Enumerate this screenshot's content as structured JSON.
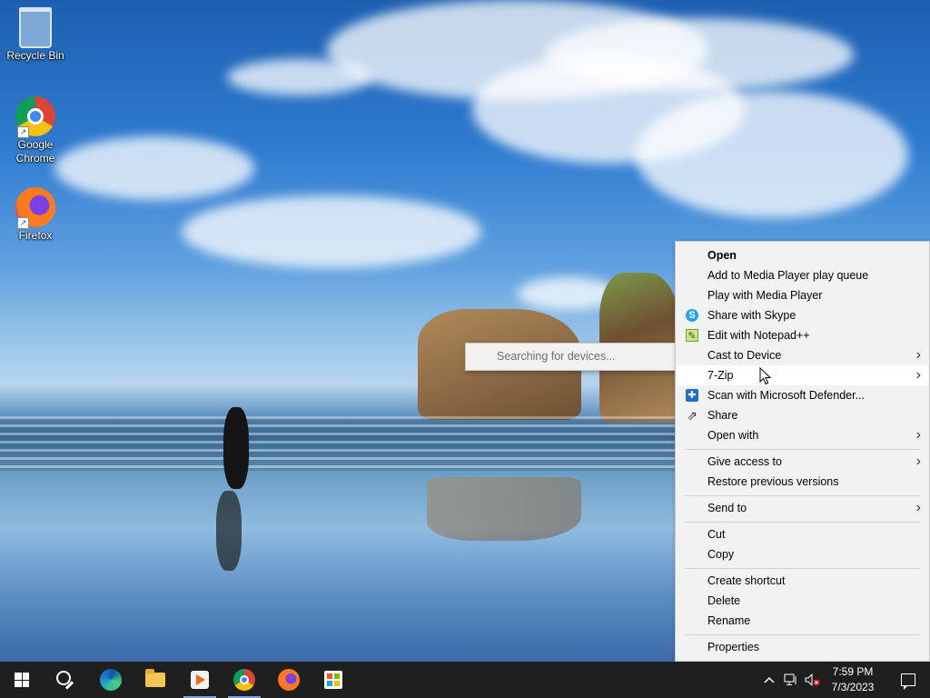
{
  "desktop": {
    "icons": [
      {
        "label": "Recycle Bin",
        "icon": "recycle-bin-icon"
      },
      {
        "label": "Google Chrome",
        "icon": "chrome-icon"
      },
      {
        "label": "Firefox",
        "icon": "firefox-icon"
      }
    ]
  },
  "context_menu": {
    "items": [
      {
        "label": "Open",
        "bold": true
      },
      {
        "label": "Add to Media Player play queue"
      },
      {
        "label": "Play with Media Player"
      },
      {
        "label": "Share with Skype",
        "icon": "skype-icon"
      },
      {
        "label": "Edit with Notepad++",
        "icon": "notepad-plus-plus-icon"
      },
      {
        "label": "Cast to Device",
        "submenu": true
      },
      {
        "label": "7-Zip",
        "submenu": true,
        "highlighted": true
      },
      {
        "label": "Scan with Microsoft Defender...",
        "icon": "defender-icon"
      },
      {
        "label": "Share",
        "icon": "share-icon"
      },
      {
        "label": "Open with",
        "submenu": true
      },
      {
        "label": "Give access to",
        "submenu": true
      },
      {
        "label": "Restore previous versions"
      },
      {
        "label": "Send to",
        "submenu": true
      },
      {
        "label": "Cut"
      },
      {
        "label": "Copy"
      },
      {
        "label": "Create shortcut"
      },
      {
        "label": "Delete"
      },
      {
        "label": "Rename"
      },
      {
        "label": "Properties"
      }
    ]
  },
  "submenu": {
    "status_text": "Searching for devices..."
  },
  "taskbar": {
    "apps": [
      "start-button",
      "search-button",
      "edge-icon",
      "file-explorer-icon",
      "media-player-icon",
      "chrome-icon",
      "firefox-icon",
      "microsoft-store-icon"
    ],
    "clock": {
      "time": "7:59 PM",
      "date": "7/3/2023"
    }
  },
  "colors": {
    "menu_bg": "#f2f2f2",
    "menu_highlight": "#ffffff",
    "taskbar_bg": "#1f1f1f",
    "submenu_text": "#6d6d6d"
  }
}
